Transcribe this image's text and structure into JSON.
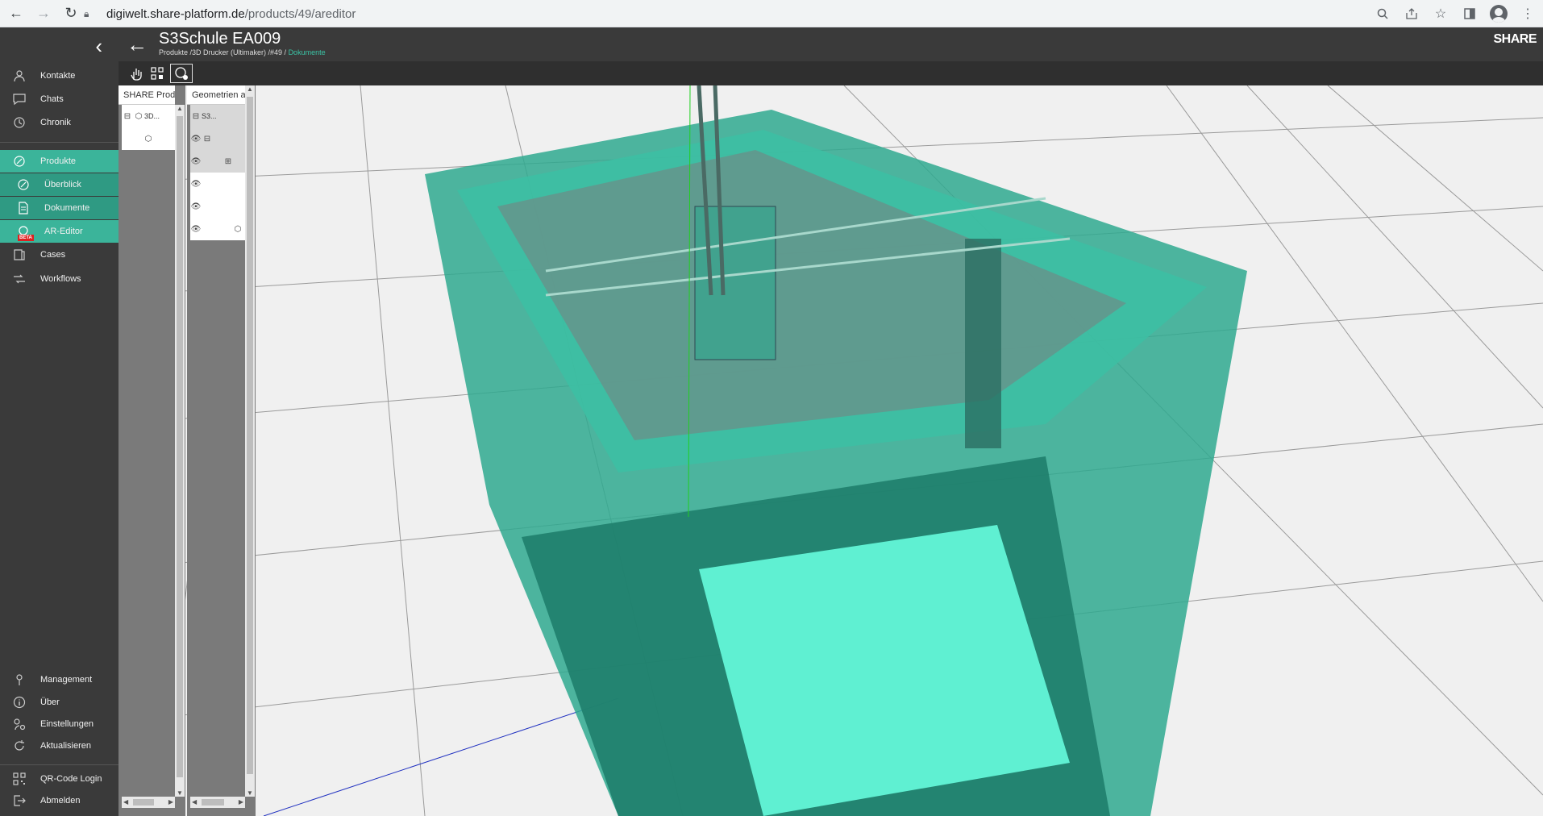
{
  "browser": {
    "url_host": "digiwelt.share-platform.de",
    "url_path": "/products/49/areditor"
  },
  "header": {
    "title": "S3Schule EA009",
    "breadcrumb_path": "Produkte /3D Drucker (Ultimaker) /#49 / ",
    "breadcrumb_current": "Dokumente",
    "logo": "SHARE"
  },
  "sidebar": {
    "top_items": [
      {
        "label": "Kontakte",
        "icon": "contacts-icon"
      },
      {
        "label": "Chats",
        "icon": "chat-icon"
      },
      {
        "label": "Chronik",
        "icon": "history-icon"
      }
    ],
    "products": {
      "label": "Produkte",
      "sub_items": [
        {
          "label": "Überblick",
          "icon": "product-overview-icon"
        },
        {
          "label": "Dokumente",
          "icon": "document-icon"
        },
        {
          "label": "AR-Editor",
          "icon": "ar-editor-icon",
          "badge": "BETA"
        }
      ]
    },
    "mid_items": [
      {
        "label": "Cases",
        "icon": "cases-icon"
      },
      {
        "label": "Workflows",
        "icon": "workflow-icon"
      }
    ],
    "bottom_items": [
      {
        "label": "Management",
        "icon": "management-icon"
      },
      {
        "label": "Über",
        "icon": "info-icon"
      },
      {
        "label": "Einstellungen",
        "icon": "settings-icon"
      },
      {
        "label": "Aktualisieren",
        "icon": "refresh-icon"
      }
    ],
    "footer_items": [
      {
        "label": "QR-Code Login",
        "icon": "qr-code-icon"
      },
      {
        "label": "Abmelden",
        "icon": "logout-icon"
      }
    ]
  },
  "panels": {
    "share_products": {
      "header": "SHARE Produkte",
      "rows": [
        {
          "label": "3D..."
        }
      ]
    },
    "geometries": {
      "header": "Geometrien aus",
      "rows": [
        {
          "label": "S3..."
        }
      ]
    }
  },
  "colors": {
    "accent": "#3bb49a",
    "sidebar_bg": "#3a3a3a",
    "model_teal": "#2fb59a"
  }
}
